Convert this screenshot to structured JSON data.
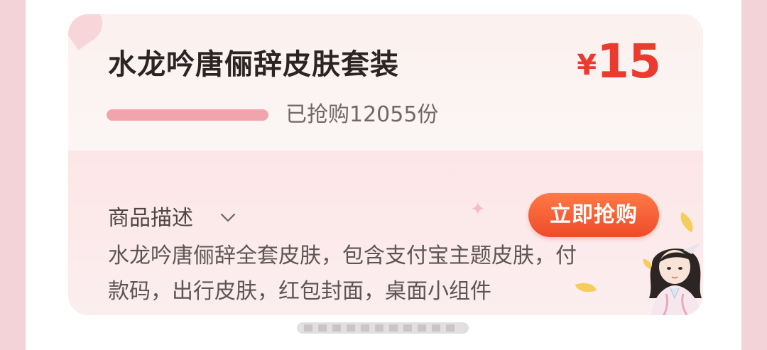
{
  "product": {
    "title": "水龙吟唐俪辞皮肤套装",
    "price_currency": "¥",
    "price_amount": "15",
    "sold_text": "已抢购12055份",
    "progress_fraction": 1.0
  },
  "description": {
    "heading": "商品描述",
    "line1": "水龙吟唐俪辞全套皮肤，包含支付宝主题皮肤，付",
    "line2": "款码，出行皮肤，红包封面，桌面小组件"
  },
  "actions": {
    "buy_label": "立即抢购"
  },
  "colors": {
    "price": "#ea3b2e",
    "button": "#ee4a2b",
    "progress": "#f1a4ab"
  }
}
